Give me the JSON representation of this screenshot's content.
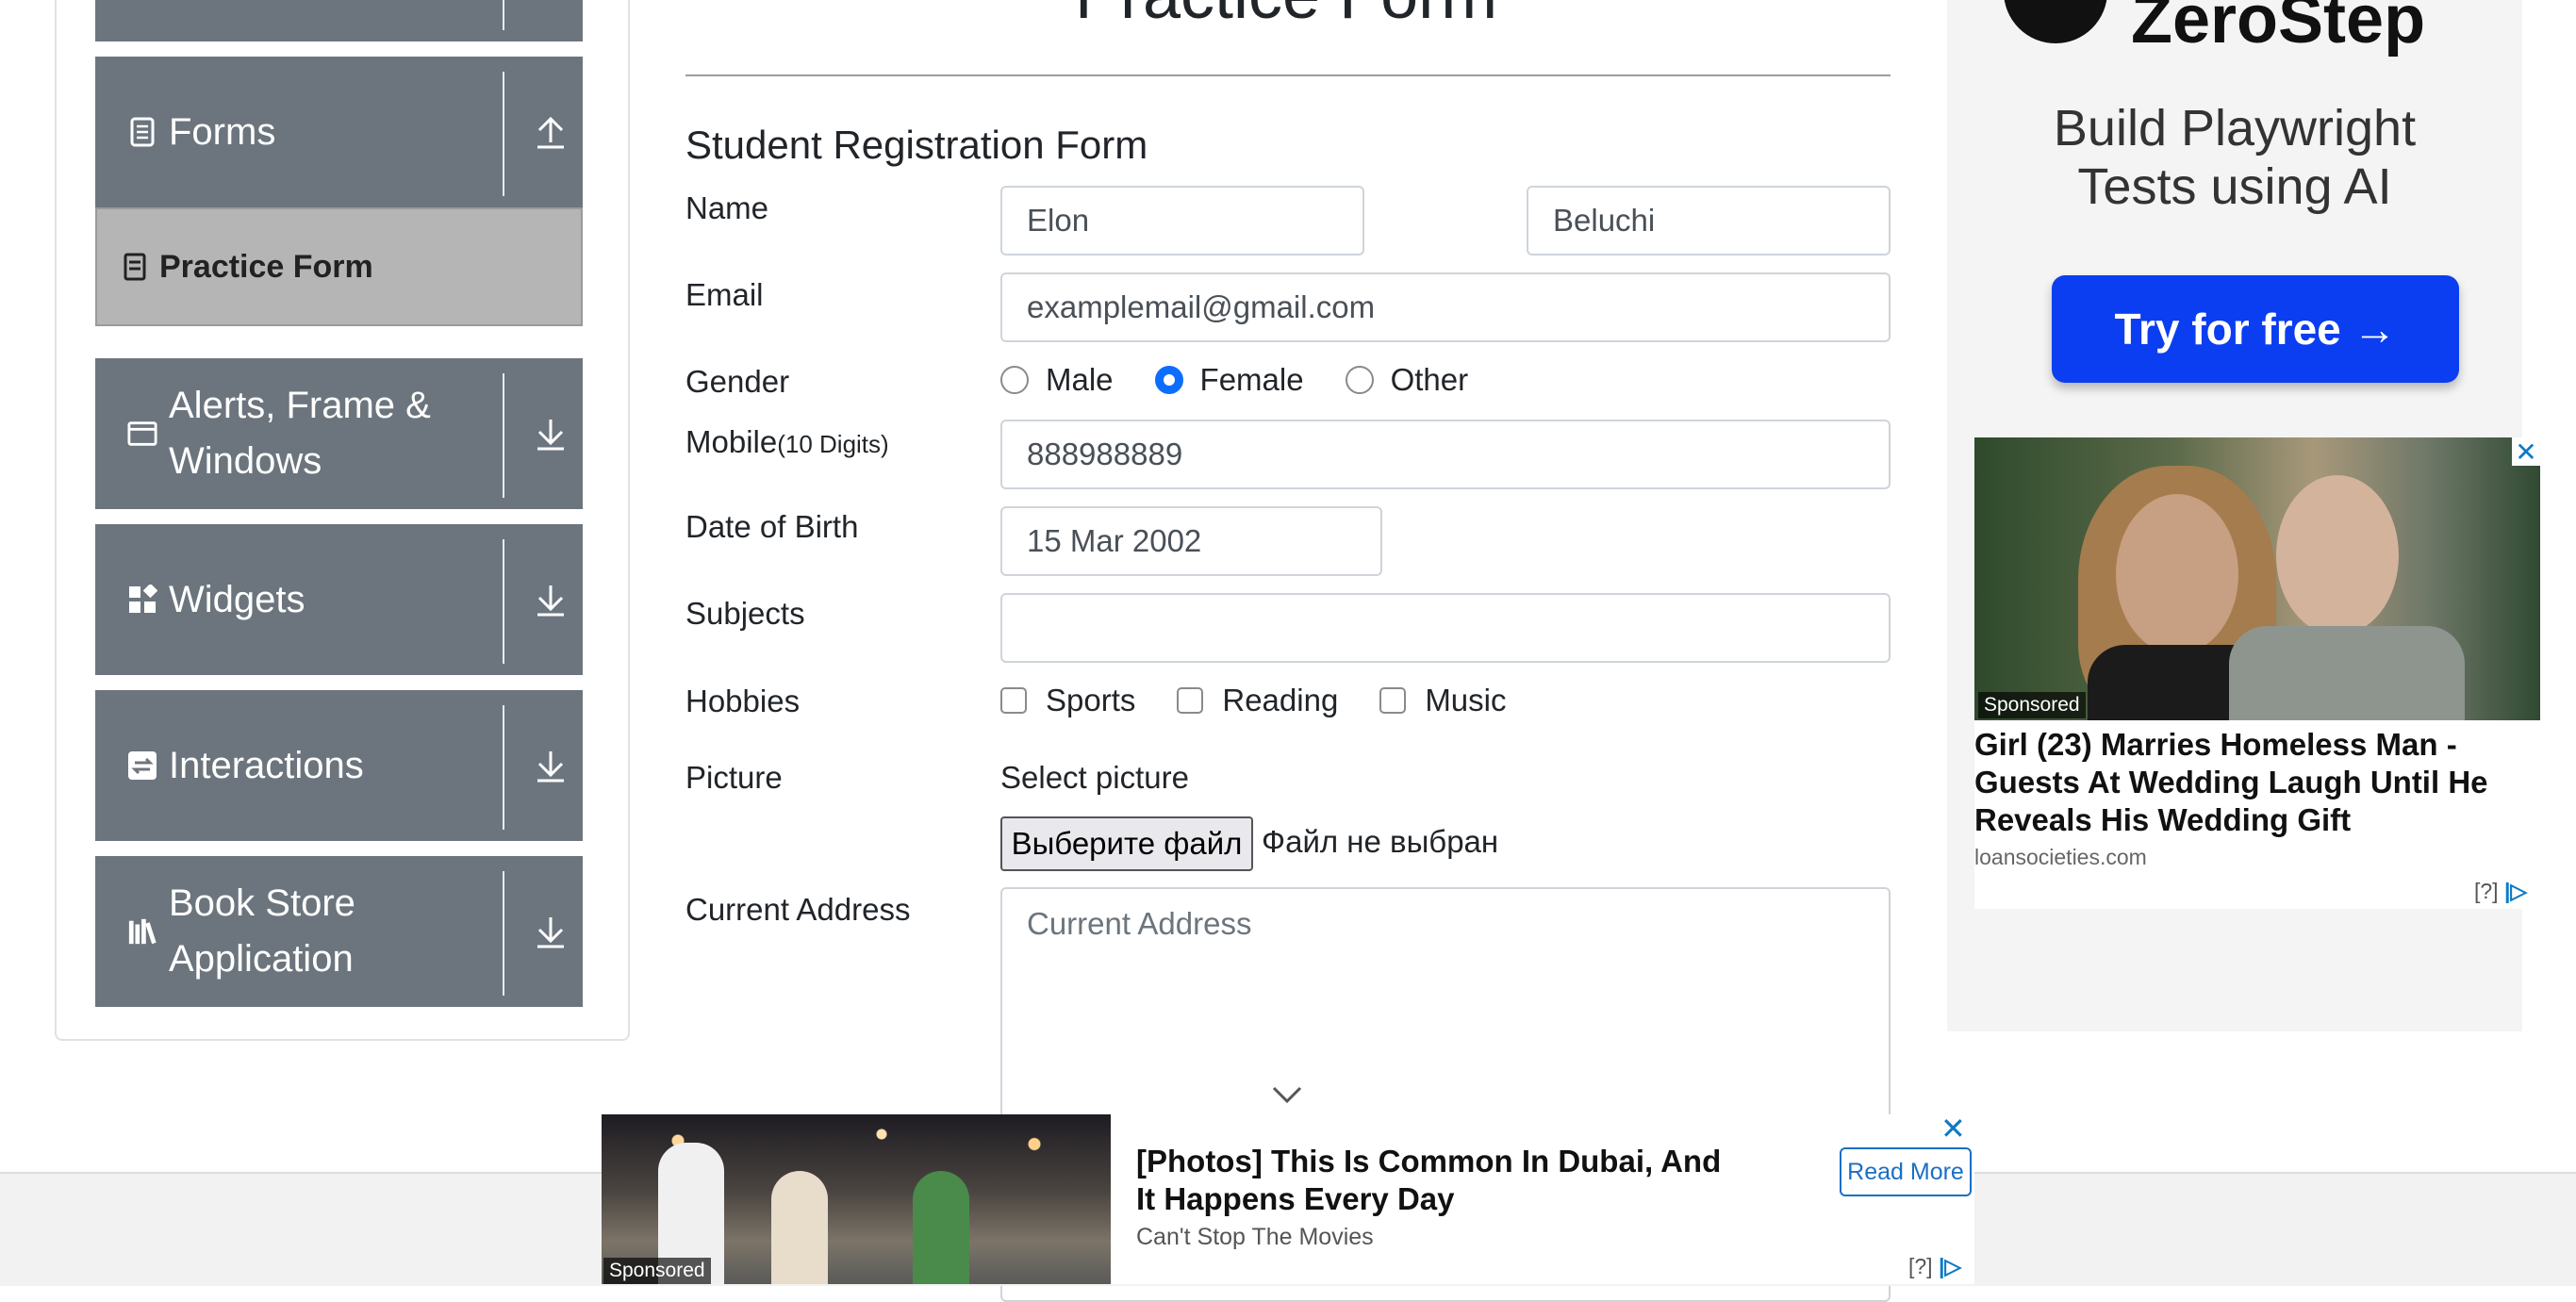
{
  "sidebar": {
    "groups": [
      {
        "label": "Forms",
        "toggle": "collapse"
      },
      {
        "label": "Alerts, Frame & Windows",
        "label_line1": "Alerts, Frame &",
        "label_line2": "Windows",
        "toggle": "expand"
      },
      {
        "label": "Widgets",
        "toggle": "expand"
      },
      {
        "label": "Interactions",
        "toggle": "expand"
      },
      {
        "label": "Book Store Application",
        "label_line1": "Book Store",
        "label_line2": "Application",
        "toggle": "expand"
      }
    ],
    "active_item": {
      "label": "Practice Form"
    }
  },
  "page": {
    "title": "Practice Form"
  },
  "form": {
    "title": "Student Registration Form",
    "name": {
      "label": "Name",
      "first_name": "Elon",
      "last_name": "Beluchi"
    },
    "email": {
      "label": "Email",
      "value": "examplemail@gmail.com"
    },
    "gender": {
      "label": "Gender",
      "options": [
        "Male",
        "Female",
        "Other"
      ],
      "selected": "Female"
    },
    "mobile": {
      "label": "Mobile",
      "hint": "(10 Digits)",
      "value": "888988889"
    },
    "dob": {
      "label": "Date of Birth",
      "value": "15 Mar 2002"
    },
    "subjects": {
      "label": "Subjects",
      "value": ""
    },
    "hobbies": {
      "label": "Hobbies",
      "options": [
        "Sports",
        "Reading",
        "Music"
      ],
      "checked": []
    },
    "picture": {
      "label": "Picture",
      "select_label": "Select picture",
      "button": "Выберите файл",
      "status": "Файл не выбран"
    },
    "address": {
      "label": "Current Address",
      "placeholder": "Current Address"
    }
  },
  "ads": {
    "zerostep": {
      "brand": "ZeroStep",
      "headline_line1": "Build Playwright",
      "headline_line2": "Tests using AI",
      "cta": "Try for free →"
    },
    "native": {
      "sponsored": "Sponsored",
      "headline": "Girl (23) Marries Homeless Man - Guests At Wedding Laugh Until He Reveals His Wedding Gift",
      "domain": "loansocieties.com",
      "adchoice": "[?]"
    },
    "bottom": {
      "sponsored": "Sponsored",
      "headline": "[Photos] This Is Common In Dubai, And It Happens Every Day",
      "domain": "Can't Stop The Movies",
      "cta": "Read More",
      "adchoice": "[?]"
    }
  },
  "colors": {
    "sidebar_group_bg": "#6c757d",
    "active_item_bg": "#b5b5b5",
    "radio_selected": "#0d6efd",
    "cta_blue": "#0b3ef0"
  }
}
